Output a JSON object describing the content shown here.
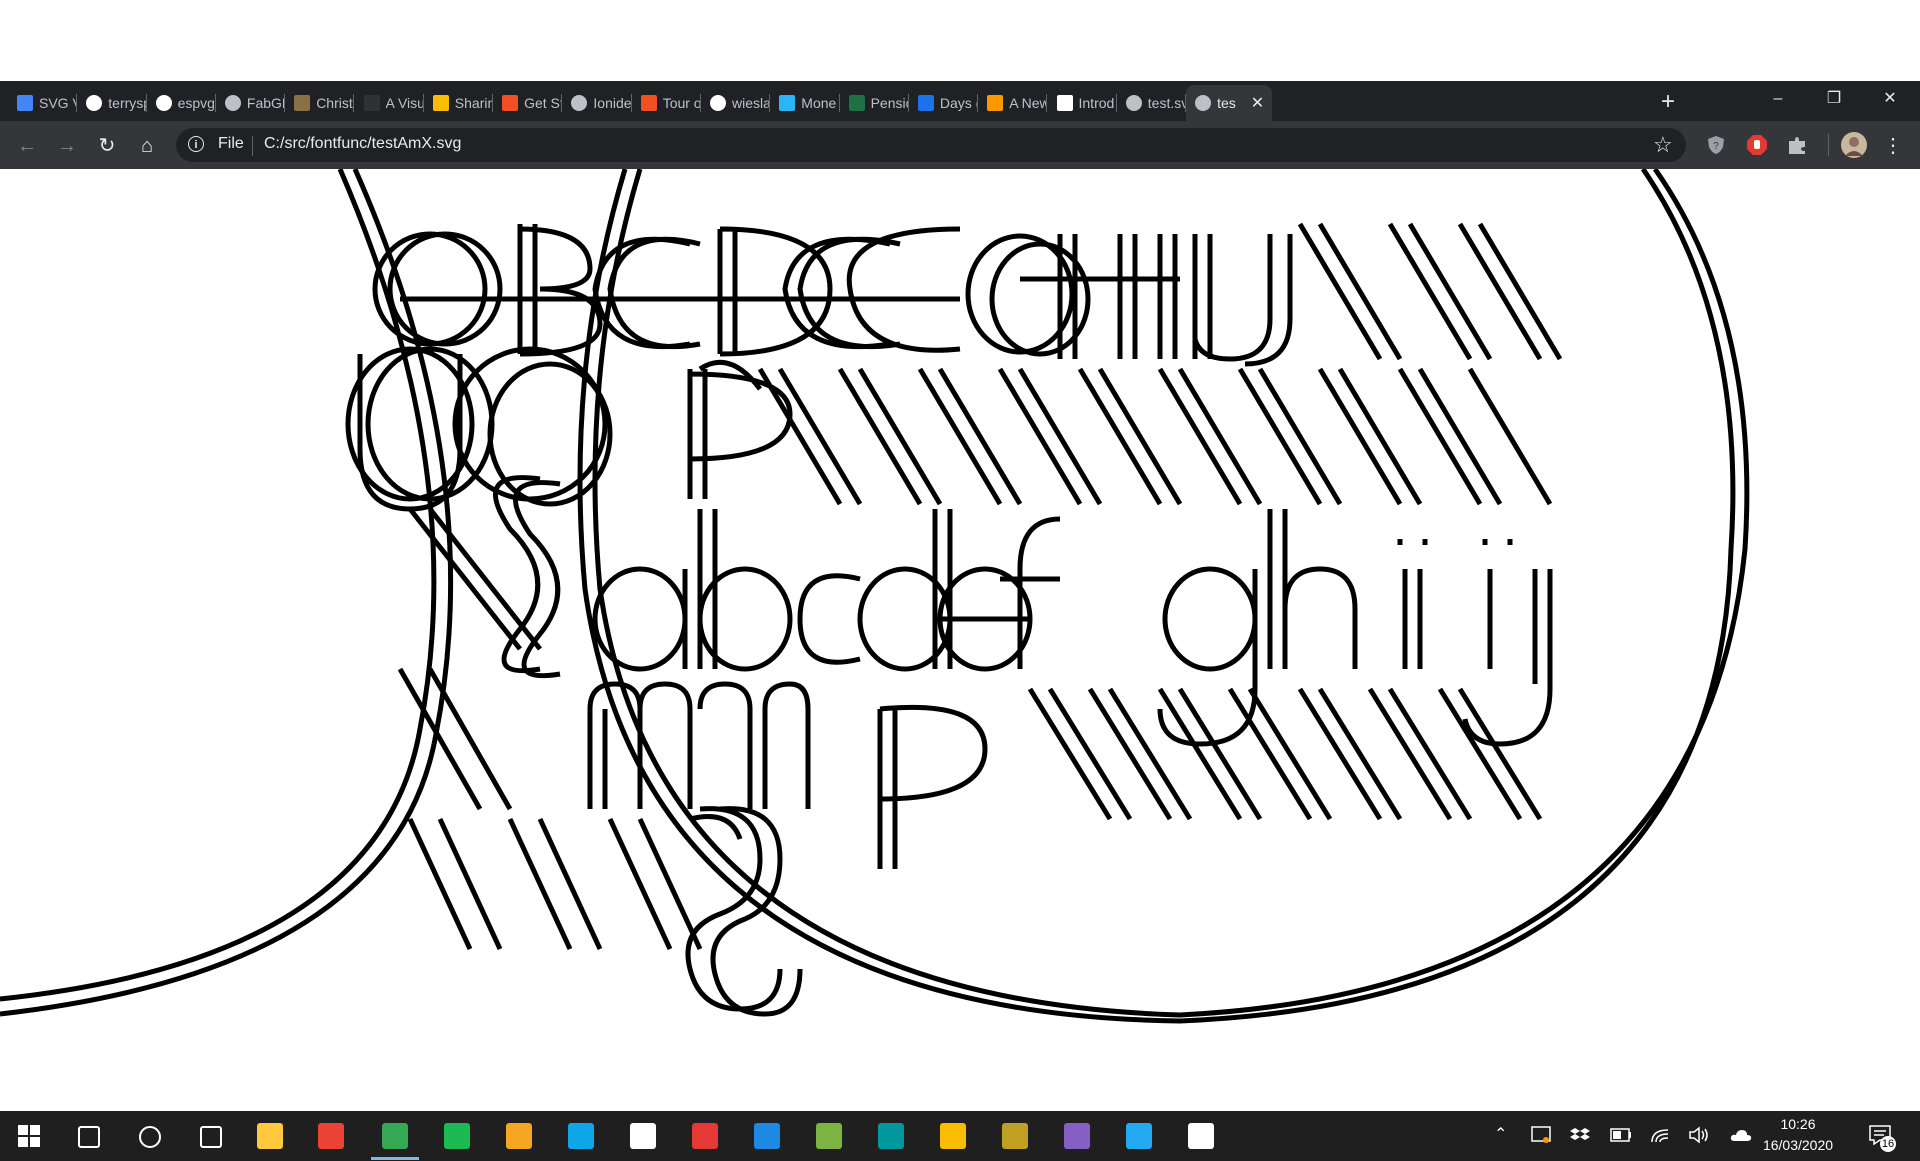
{
  "browser": {
    "tabs": [
      {
        "label": "SVG Vi",
        "icon": "svg-viewer-icon",
        "color": "#4285f4"
      },
      {
        "label": "terrysp",
        "icon": "github-icon",
        "color": "#ffffff"
      },
      {
        "label": "espvgi",
        "icon": "github-icon",
        "color": "#ffffff"
      },
      {
        "label": "FabGL",
        "icon": "globe-icon",
        "color": "#bdc1c6"
      },
      {
        "label": "Christ",
        "icon": "christ-thumbnail-icon",
        "color": "#8b6f47"
      },
      {
        "label": "A Visu",
        "icon": "a-visual-icon",
        "color": "#303134"
      },
      {
        "label": "Sharin",
        "icon": "pinwheel-icon",
        "color": "#fbbc05"
      },
      {
        "label": "Get St",
        "icon": "microsoft-icon",
        "color": "#f25022"
      },
      {
        "label": "Ionide",
        "icon": "globe-icon",
        "color": "#bdc1c6"
      },
      {
        "label": "Tour o",
        "icon": "microsoft-icon",
        "color": "#f25022"
      },
      {
        "label": "wiesla",
        "icon": "github-icon",
        "color": "#ffffff"
      },
      {
        "label": "Mone",
        "icon": "money-icon",
        "color": "#29b6f6"
      },
      {
        "label": "Pensio",
        "icon": "excel-icon",
        "color": "#1e7145"
      },
      {
        "label": "Days (",
        "icon": "days-diamond-icon",
        "color": "#1a73e8"
      },
      {
        "label": "A New",
        "icon": "sun-icon",
        "color": "#ff9800"
      },
      {
        "label": "Introd",
        "icon": "mortarboard-icon",
        "color": "#ffffff"
      },
      {
        "label": "test.sv",
        "icon": "globe-icon",
        "color": "#bdc1c6"
      },
      {
        "label": "tes",
        "icon": "globe-icon",
        "color": "#bdc1c6",
        "active": true
      }
    ],
    "new_tab_label": "+",
    "window_controls": {
      "minimize": "–",
      "restore": "❐",
      "close": "✕"
    },
    "nav": {
      "back": "←",
      "forward": "→",
      "reload": "↻",
      "home": "⌂"
    },
    "omnibox": {
      "info": "i",
      "scheme_label": "File",
      "url": "C:/src/fontfunc/testAmX.svg"
    },
    "bookmark_star": "☆",
    "menu_dots": "⋮"
  },
  "content": {
    "stroke_color": "#000000",
    "background": "#ffffff"
  },
  "taskbar": {
    "start_icon": "windows-start-icon",
    "apps": [
      {
        "name": "search-icon"
      },
      {
        "name": "cortana-icon"
      },
      {
        "name": "task-view-icon"
      },
      {
        "name": "file-explorer-icon",
        "color": "#ffc83d"
      },
      {
        "name": "gmail-icon",
        "color": "#ea4335"
      },
      {
        "name": "chrome-icon",
        "color": "#34a853",
        "running": true
      },
      {
        "name": "spotify-icon",
        "color": "#1db954"
      },
      {
        "name": "f-app-icon",
        "color": "#f5a623"
      },
      {
        "name": "c-app-icon",
        "color": "#0ea5e9"
      },
      {
        "name": "notepad-icon",
        "color": "#ffffff"
      },
      {
        "name": "xmind-icon",
        "color": "#e53935"
      },
      {
        "name": "terminal-app-icon",
        "color": "#1e88e5"
      },
      {
        "name": "notes-app-icon",
        "color": "#7cb342"
      },
      {
        "name": "arduino-icon",
        "color": "#00979d"
      },
      {
        "name": "keep-icon",
        "color": "#fbbc04"
      },
      {
        "name": "globe-app-icon",
        "color": "#c0a020"
      },
      {
        "name": "visual-studio-icon",
        "color": "#865fc5"
      },
      {
        "name": "vscode-icon",
        "color": "#23a9f2"
      },
      {
        "name": "mountain-app-icon",
        "color": "#ffffff"
      }
    ],
    "tray": {
      "chevron": "⌃",
      "time": "10:26",
      "date": "16/03/2020",
      "notification_count": "16"
    }
  }
}
